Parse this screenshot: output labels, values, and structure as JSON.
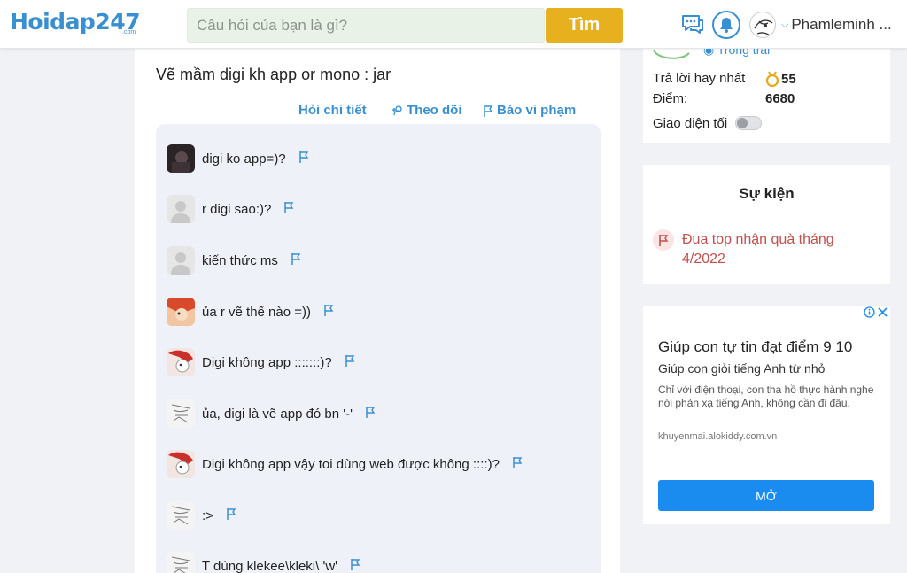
{
  "header": {
    "logo_main": "Hoidap247",
    "logo_sub": ".com",
    "search_placeholder": "Câu hỏi của bạn là gì?",
    "search_button": "Tìm",
    "username": "Phamleminh ..."
  },
  "question": {
    "text": "Vẽ mầm digi kh app or mono : jar",
    "actions": {
      "detail": "Hỏi chi tiết",
      "follow": "Theo dõi",
      "report": "Báo vi phạm"
    }
  },
  "comments": [
    {
      "text": "digi ko app=)?",
      "avatar": "dark-photo"
    },
    {
      "text": "r digi sao:)?",
      "avatar": "default"
    },
    {
      "text": "kiến thức ms",
      "avatar": "default"
    },
    {
      "text": "ủa r vẽ thế nào =))",
      "avatar": "anime-red"
    },
    {
      "text": "Digi không app :::::::)?",
      "avatar": "red-character"
    },
    {
      "text": "ủa, digi là vẽ app đó bn '-'",
      "avatar": "sketch"
    },
    {
      "text": "Digi không app vậy toi dùng web được không ::::)?",
      "avatar": "red-character"
    },
    {
      "text": ":>",
      "avatar": "sketch"
    },
    {
      "text": "T dùng klekee\\kleki\\ 'w'",
      "avatar": "sketch"
    }
  ],
  "sidebar": {
    "status_label": "Trống trải",
    "best_answers_label": "Trả lời hay nhất",
    "best_answers_value": "55",
    "points_label": "Điểm:",
    "points_value": "6680",
    "dark_mode_label": "Giao diện tối"
  },
  "event": {
    "title": "Sự kiện",
    "item": "Đua top nhận quà tháng 4/2022"
  },
  "ad": {
    "headline": "Giúp con tự tin đạt điểm 9 10",
    "subheadline": "Giúp con giỏi tiếng Anh từ nhỏ",
    "body": "Chỉ với điện thoại, con tha hồ thực hành nghe nói phản xạ tiếng Anh, không cần đi đâu.",
    "url": "khuyenmai.alokiddy.com.vn",
    "button": "MỞ"
  },
  "colors": {
    "accent": "#3a8fd1",
    "search_button": "#e6b01e",
    "event_text": "#c0504d",
    "ad_button": "#1a8cf0"
  }
}
